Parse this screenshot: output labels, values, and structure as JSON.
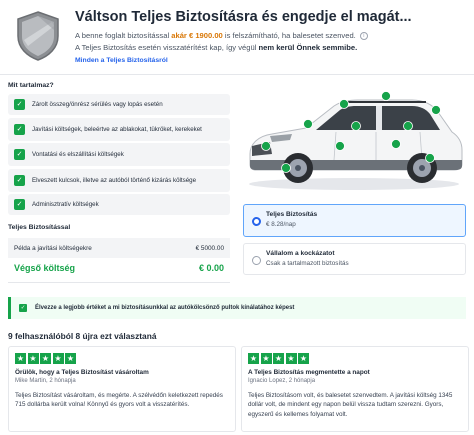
{
  "header": {
    "title": "Váltson Teljes Biztosításra és engedje el magát...",
    "line1_prefix": "A benne foglalt biztosítással",
    "line1_accent": "akár € 1900.00",
    "line1_suffix": "is felszámítható, ha balesetet szenved.",
    "info_icon": "i",
    "line2_prefix": "A Teljes Biztosítás esetén visszatérítést kap, így végül",
    "line2_bold": "nem kerül Önnek semmibe.",
    "link": "Minden a Teljes Biztosításról"
  },
  "coverage": {
    "label": "Mit tartalmaz?",
    "items": [
      {
        "label": "Zárolt összeg/önrész sérülés vagy lopás esetén"
      },
      {
        "label": "Javítási költségek, beleértve az ablakokat, tükröket, kerekeket"
      },
      {
        "label": "Vontatási és elszállítási költségek"
      },
      {
        "label": "Elveszett kulcsok, illetve az autóból történő kizárás költsége"
      },
      {
        "label": "Adminisztratív költségek"
      }
    ]
  },
  "insurance": {
    "label": "Teljes Biztosítással",
    "row_label": "Példa a javítási költségekre",
    "row_value": "€ 5000.00",
    "total_label": "Végső költség",
    "total_value": "€ 0.00"
  },
  "options": [
    {
      "title": "Teljes Biztosítás",
      "sub": "€ 8.28/nap",
      "selected": true
    },
    {
      "title": "Vállalom a kockázatot",
      "sub": "Csak a tartalmazott biztosítás",
      "selected": false
    }
  ],
  "banner": {
    "text": "Élvezze a legjobb értéket a mi biztosításunkkal az autókölcsönző pultok kínálatához képest"
  },
  "reviews": {
    "heading": "9 felhasználóból 8 újra ezt választaná",
    "items": [
      {
        "stars": 5,
        "title": "Örülök, hogy a Teljes Biztosítást vásároltam",
        "meta": "Mike Martin, 2 hónapja",
        "body": "Teljes Biztosítást vásároltam, és megérte. A szélvédőn keletkezett repedés 715 dollárba került volna! Könnyű és gyors volt a visszatérítés."
      },
      {
        "stars": 5,
        "title": "A Teljes Biztosítás megmentette a napot",
        "meta": "Ignacio Lopez, 2 hónapja",
        "body": "Teljes Biztosításom volt, és balesetet szenvedtem. A javítási költség 1345 dollár volt, de mindent egy napon belül vissza tudtam szerezni. Gyors, egyszerű és kellemes folyamat volt."
      }
    ]
  },
  "colors": {
    "accent_green": "#16a34a",
    "accent_blue": "#2563eb",
    "accent_orange": "#d97706"
  }
}
